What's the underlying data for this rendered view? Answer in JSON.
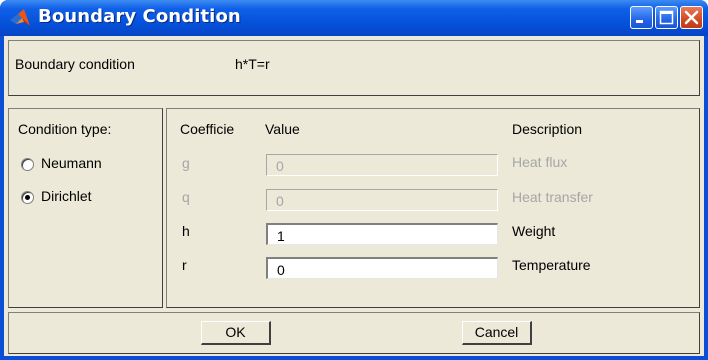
{
  "window": {
    "title": "Boundary Condition"
  },
  "header": {
    "label": "Boundary condition",
    "equation": "h*T=r"
  },
  "condition_type": {
    "label": "Condition type:",
    "options": [
      {
        "label": "Neumann",
        "selected": false
      },
      {
        "label": "Dirichlet",
        "selected": true
      }
    ]
  },
  "table": {
    "headers": {
      "coefficient": "Coefficie",
      "value": "Value",
      "description": "Description"
    },
    "rows": [
      {
        "coefficient": "g",
        "value": "0",
        "description": "Heat flux",
        "enabled": false
      },
      {
        "coefficient": "q",
        "value": "0",
        "description": "Heat transfer",
        "enabled": false
      },
      {
        "coefficient": "h",
        "value": "1",
        "description": "Weight",
        "enabled": true
      },
      {
        "coefficient": "r",
        "value": "0",
        "description": "Temperature",
        "enabled": true
      }
    ]
  },
  "buttons": {
    "ok": "OK",
    "cancel": "Cancel"
  },
  "colors": {
    "titlebar": "#0450d8",
    "dialog_bg": "#ece9d8",
    "disabled_text": "#a6a6a6"
  }
}
